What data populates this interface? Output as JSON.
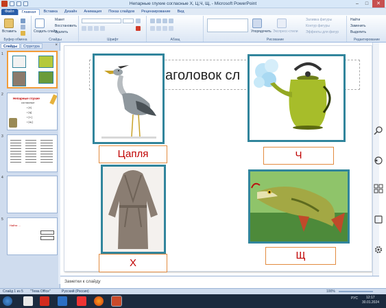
{
  "window": {
    "title": "Непарные глухие согласные Х, Ц,Ч, Щ, - Microsoft PowerPoint",
    "controls": [
      "–",
      "□",
      "✕"
    ]
  },
  "ribbon_tabs": [
    "Файл",
    "Главная",
    "Вставка",
    "Дизайн",
    "Анимация",
    "Показ слайдов",
    "Рецензирование",
    "Вид"
  ],
  "ribbon": {
    "clipboard": {
      "label": "Буфер обмена",
      "paste": "Вставить"
    },
    "slides": {
      "label": "Слайды",
      "new": "Создать слайд",
      "layout": "Макет",
      "reset": "Восстановить",
      "delete": "Удалить"
    },
    "font": {
      "label": "Шрифт"
    },
    "paragraph": {
      "label": "Абзац"
    },
    "drawing": {
      "label": "Рисование",
      "arrange": "Упорядочить",
      "quick_styles": "Экспресс-стили",
      "fill": "Заливка фигуры",
      "outline": "Контур фигуры",
      "effects": "Эффекты для фигур"
    },
    "editing": {
      "label": "Редактирование",
      "find": "Найти",
      "replace": "Заменить",
      "select": "Выделить"
    }
  },
  "left_panel": {
    "tabs": [
      "Слайды",
      "Структура"
    ],
    "close": "×",
    "slide2_title": "Непарные глухие",
    "slide2_subtitle": "согласные",
    "slide2_items": [
      "• [х]",
      "• [ц]",
      "• [ч ]",
      "• [щ ]"
    ],
    "slide5_text": "Найти ..."
  },
  "slide": {
    "title_placeholder": "аголовок сл",
    "labels": [
      "Цапля",
      "Ч",
      "Х",
      "Щ"
    ]
  },
  "notes": {
    "placeholder": "Заметки к слайду"
  },
  "status": {
    "slide_of": "Слайд 1 из 5",
    "theme": "\"Тема Office\"",
    "language": "Русский (Россия)",
    "zoom": "100%"
  },
  "taskbar": {
    "lang": "РУС",
    "time": "12:17",
    "date": "30.01.2024"
  }
}
